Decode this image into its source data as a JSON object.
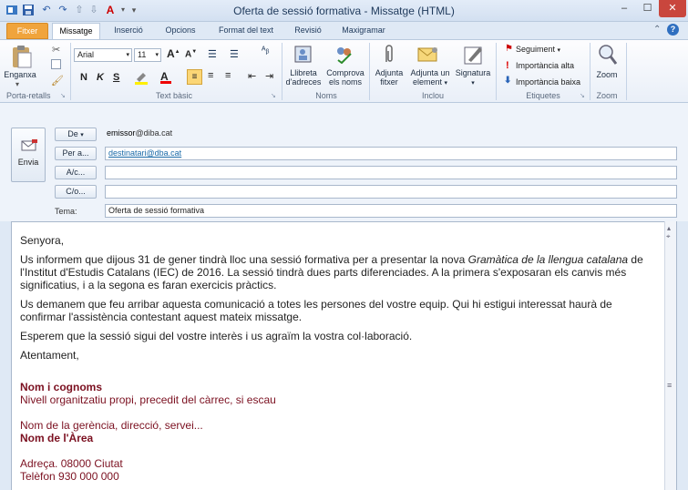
{
  "window": {
    "title": "Oferta de sessió formativa - Missatge (HTML)"
  },
  "tabs": [
    {
      "label": "Fitxer"
    },
    {
      "label": "Missatge"
    },
    {
      "label": "Inserció"
    },
    {
      "label": "Opcions"
    },
    {
      "label": "Format del text"
    },
    {
      "label": "Revisió"
    },
    {
      "label": "Maxigramar"
    }
  ],
  "ribbon": {
    "clipboard": {
      "paste": "Enganxa",
      "group": "Porta-retalls"
    },
    "basic_text": {
      "font": "Arial",
      "size": "11",
      "bold": "N",
      "italic": "K",
      "underline": "S",
      "group": "Text bàsic"
    },
    "names": {
      "address_book": "Llibreta",
      "address_book2": "d'adreces",
      "check": "Comprova",
      "check2": "els noms",
      "group": "Noms"
    },
    "include": {
      "attach_file": "Adjunta",
      "attach_file2": "fitxer",
      "attach_item": "Adjunta un",
      "attach_item2": "element",
      "signature": "Signatura",
      "group": "Inclou"
    },
    "tags": {
      "followup": "Seguiment",
      "high": "Importància alta",
      "low": "Importància baixa",
      "group": "Etiquetes"
    },
    "zoom": {
      "zoom": "Zoom",
      "group": "Zoom"
    }
  },
  "compose": {
    "send": "Envia",
    "from_btn": "De",
    "from_value_bold": "emissor",
    "from_value_rest": "@diba.cat",
    "to_btn": "Per a...",
    "to_value": "destinatari@dba.cat",
    "cc_btn": "A/c...",
    "bcc_btn": "C/o...",
    "subject_label": "Tema:",
    "subject_value": "Oferta de sessió formativa"
  },
  "body": {
    "greeting": "Senyora,",
    "p1_a": "Us informem que dijous 31 de gener tindrà lloc una sessió formativa per a presentar la nova ",
    "p1_italic": "Gramàtica de la llengua catalana",
    "p1_b": " de l'Institut d'Estudis Catalans (IEC) de 2016. La sessió tindrà dues parts diferenciades. A la primera s'exposaran els canvis més significatius, i a la segona es faran exercicis pràctics.",
    "p2": "Us demanem que feu arribar aquesta comunicació a totes les persones del vostre equip. Qui hi estigui interessat haurà de confirmar l'assistència contestant aquest mateix missatge.",
    "p3": "Esperem que la sessió sigui del vostre interès i us agraïm la vostra col·laboració.",
    "closing": "Atentament,",
    "sig_name": "Nom i cognoms",
    "sig_org": "Nivell organitzatiu propi, precedit del càrrec, si escau",
    "sig_dept": "Nom de la gerència, direcció, servei...",
    "sig_area": "Nom de l'Àrea",
    "sig_address": "Adreça. 08000 Ciutat",
    "sig_phone": "Telèfon 930 000 000"
  },
  "colors": {
    "accent_file_tab": "#f0a43c",
    "signature_maroon": "#7b1020",
    "link": "#1a6aa8"
  }
}
